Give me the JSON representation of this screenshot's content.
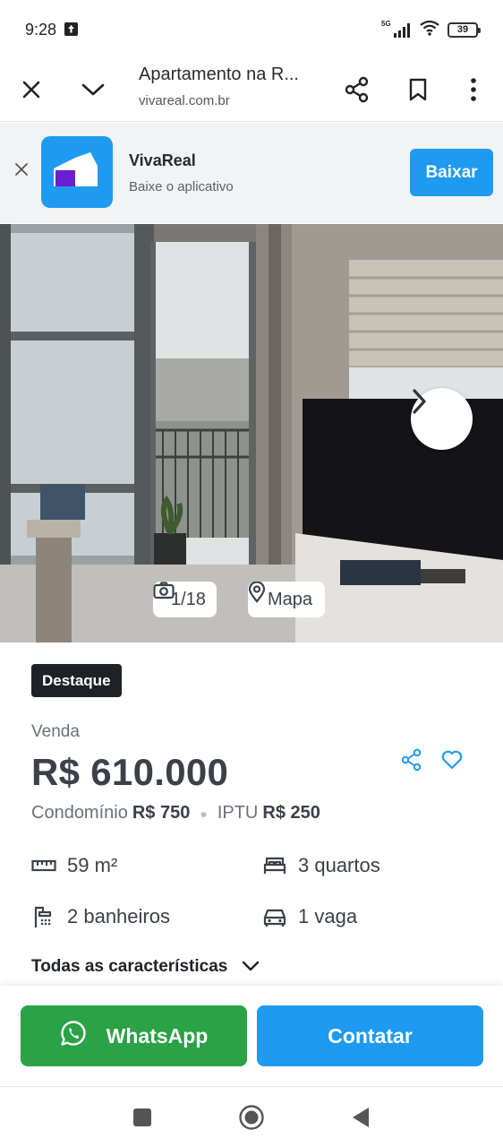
{
  "status_bar": {
    "time": "9:28",
    "network": "5G",
    "battery": "39"
  },
  "browser": {
    "title": "Apartamento na R...",
    "domain": "vivareal.com.br"
  },
  "app_banner": {
    "name": "VivaReal",
    "subtitle": "Baixe o aplicativo",
    "button": "Baixar",
    "brand_color": "#1e9bf0",
    "logo_colors": [
      "#ffffff",
      "#6a1fd1"
    ]
  },
  "gallery": {
    "counter": "1/18",
    "map_label": "Mapa"
  },
  "listing": {
    "badge": "Destaque",
    "transaction": "Venda",
    "price": "R$ 610.000",
    "condo_label": "Condomínio",
    "condo_value": "R$ 750",
    "iptu_label": "IPTU",
    "iptu_value": "R$ 250",
    "features": {
      "area": "59 m²",
      "bedrooms": "3 quartos",
      "bathrooms": "2 banheiros",
      "parking": "1 vaga"
    },
    "all_features": "Todas as características"
  },
  "cta": {
    "whatsapp": "WhatsApp",
    "contact": "Contatar",
    "whatsapp_color": "#2aa246",
    "contact_color": "#1e9bf0"
  }
}
